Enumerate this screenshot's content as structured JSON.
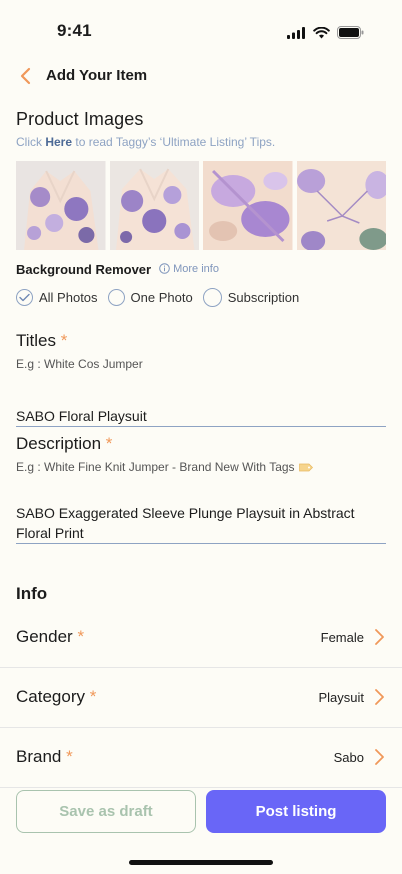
{
  "status_bar": {
    "time": "9:41"
  },
  "header": {
    "title": "Add Your Item"
  },
  "product_images": {
    "title": "Product Images",
    "tip_prefix": "Click ",
    "tip_link": "Here",
    "tip_suffix": " to read Taggy’s ‘Ultimate Listing’ Tips."
  },
  "background_remover": {
    "label": "Background Remover",
    "more_info": "More info",
    "options": [
      {
        "label": "All Photos",
        "selected": true
      },
      {
        "label": "One Photo",
        "selected": false
      },
      {
        "label": "Subscription",
        "selected": false
      }
    ]
  },
  "titles": {
    "label": "Titles",
    "required": "*",
    "hint": "E.g : White Cos Jumper",
    "value": "SABO Floral Playsuit"
  },
  "description": {
    "label": "Description",
    "required": "*",
    "hint": "E.g :  White Fine Knit Jumper - Brand New With Tags",
    "value": "SABO Exaggerated Sleeve Plunge Playsuit in Abstract Floral Print"
  },
  "info": {
    "title": "Info",
    "rows": [
      {
        "label": "Gender",
        "required": "*",
        "value": "Female"
      },
      {
        "label": "Category",
        "required": "*",
        "value": "Playsuit"
      },
      {
        "label": "Brand",
        "required": "*",
        "value": "Sabo"
      }
    ]
  },
  "footer": {
    "draft_label": "Save as draft",
    "post_label": "Post listing"
  },
  "colors": {
    "accent": "#6966f7",
    "required": "#f0985a",
    "draft_border": "#a9c3ae",
    "background": "#fdfcf6"
  }
}
